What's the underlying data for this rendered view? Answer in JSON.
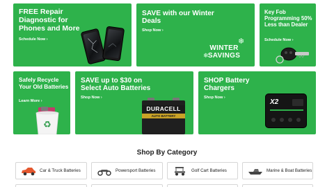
{
  "promos": {
    "repair": {
      "title": "FREE Repair Diagnostic for Phones and More",
      "link": "Schedule Now"
    },
    "winter": {
      "title": "SAVE with our Winter Deals",
      "link": "Shop Now",
      "badge_line1": "WINTER",
      "badge_line2": "SAVINGS"
    },
    "keyfob": {
      "title": "Key Fob Programming 50% Less than Dealer",
      "link": "Schedule Now"
    },
    "recycle": {
      "title": "Safely Recycle Your Old Batteries",
      "link": "Learn More"
    },
    "save30": {
      "title": "SAVE up to $30 on Select Auto Batteries",
      "link": "Shop Now",
      "battery_brand": "DURACELL",
      "battery_sub": "AUTO BATTERY"
    },
    "chargers": {
      "title": "SHOP Battery Chargers",
      "link": "Shop Now",
      "charger_brand": "X2"
    }
  },
  "categories": {
    "heading": "Shop By Category",
    "items": [
      {
        "label": "Car & Truck Batteries",
        "icon": "car-icon"
      },
      {
        "label": "Powersport Batteries",
        "icon": "atv-icon"
      },
      {
        "label": "Golf Cart Batteries",
        "icon": "golf-cart-icon"
      },
      {
        "label": "Marine & Boat Batteries",
        "icon": "boat-icon"
      }
    ]
  },
  "colors": {
    "promo_green": "#2eb24b",
    "car_icon": "#e4572e"
  }
}
